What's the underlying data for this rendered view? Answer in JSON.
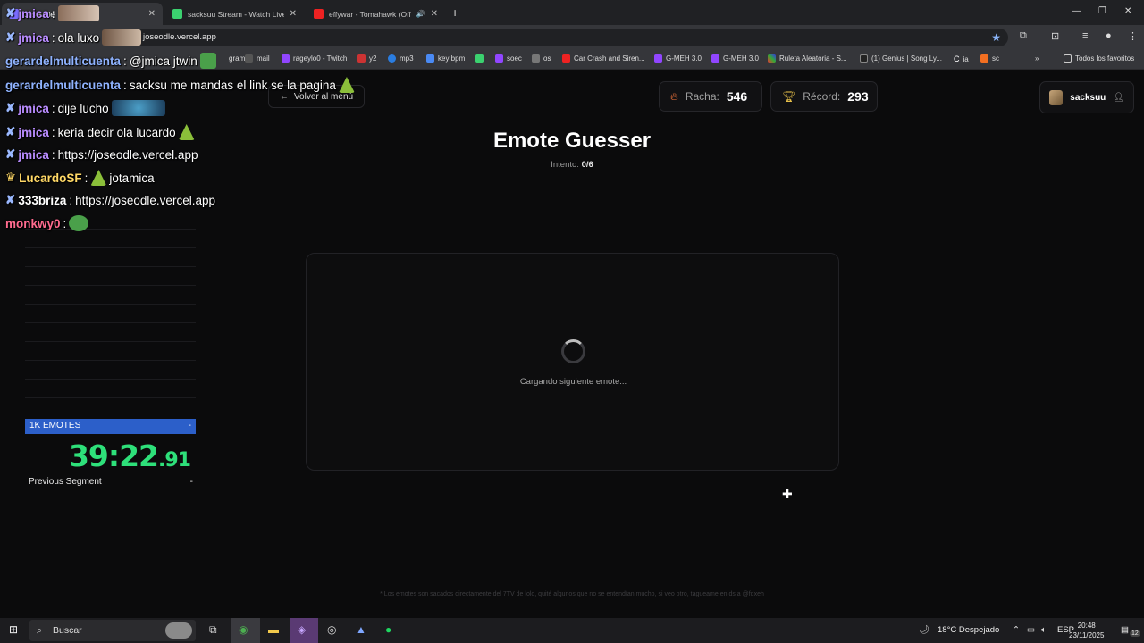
{
  "browser": {
    "tabs": [
      {
        "title": "Joseodle",
        "active": true
      },
      {
        "title": "sacksuu Stream - Watch Live on",
        "active": false
      },
      {
        "title": "effywar - Tomahawk (Officia",
        "active": false
      }
    ],
    "url": "joseodle.vercel.app",
    "bookmarks": [
      "gram",
      "mail",
      "rageylo0 - Twitch",
      "y2",
      "mp3",
      "key bpm",
      "soec",
      "os",
      "Car Crash and Siren...",
      "G-MEH 3.0",
      "G-MEH 3.0",
      "Ruleta Aleatoria - S...",
      "(1) Genius | Song Ly...",
      "ia",
      "sc"
    ],
    "all_bookmarks": "Todos los favoritos"
  },
  "page": {
    "back_label": "Volver al menú",
    "streak_label": "Racha:",
    "streak_value": "546",
    "record_label": "Récord:",
    "record_value": "293",
    "username": "sacksuu",
    "title": "Emote Guesser",
    "attempt_label": "Intento:",
    "attempt_value": "0/6",
    "loading_text": "Cargando siguiente emote...",
    "footer_note": "* Los emotes son sacados directamente del 7TV de lolo, quité algunos que no se entendían mucho, si veo otro, tagueame en ds a @fdxeh"
  },
  "chat": [
    {
      "nick": "jmica",
      "nick_color": "#b98cff",
      "message": "",
      "badge": true
    },
    {
      "nick": "jmica",
      "nick_color": "#b98cff",
      "message": "ola luxo",
      "badge": true
    },
    {
      "nick": "gerardelmulticuenta",
      "nick_color": "#8fb3ff",
      "message": "@jmica jtwin",
      "badge": false
    },
    {
      "nick": "gerardelmulticuenta",
      "nick_color": "#8fb3ff",
      "message": "sacksu me mandas el link se la pagina",
      "badge": false
    },
    {
      "nick": "jmica",
      "nick_color": "#b98cff",
      "message": "dije lucho",
      "badge": true
    },
    {
      "nick": "jmica",
      "nick_color": "#b98cff",
      "message": "keria decir ola lucardo",
      "badge": true
    },
    {
      "nick": "jmica",
      "nick_color": "#b98cff",
      "message": "https://joseodle.vercel.app",
      "badge": true
    },
    {
      "nick": "LucardoSF",
      "nick_color": "#ffd866",
      "message": "jotamica",
      "badge": false
    },
    {
      "nick": "333briza",
      "nick_color": "#ffffff",
      "message": "https://joseodle.vercel.app",
      "badge": true
    },
    {
      "nick": "monkwy0",
      "nick_color": "#ff6b8f",
      "message": "",
      "badge": false
    }
  ],
  "splits": {
    "category": "1K EMOTES",
    "timer_main": "39:22",
    "timer_fraction": ".91",
    "previous_segment_label": "Previous Segment",
    "previous_segment_value": "-",
    "head_value": "-"
  },
  "taskbar": {
    "search_placeholder": "Buscar",
    "weather": "18°C  Despejado",
    "language": "ESP",
    "time": "20:48",
    "date": "23/11/2025",
    "notifications": "12"
  },
  "colors": {
    "accent_blue": "#2c5fc9",
    "timer_green": "#2ee07a",
    "fire": "#ff7a3d",
    "trophy": "#e7c04a"
  }
}
